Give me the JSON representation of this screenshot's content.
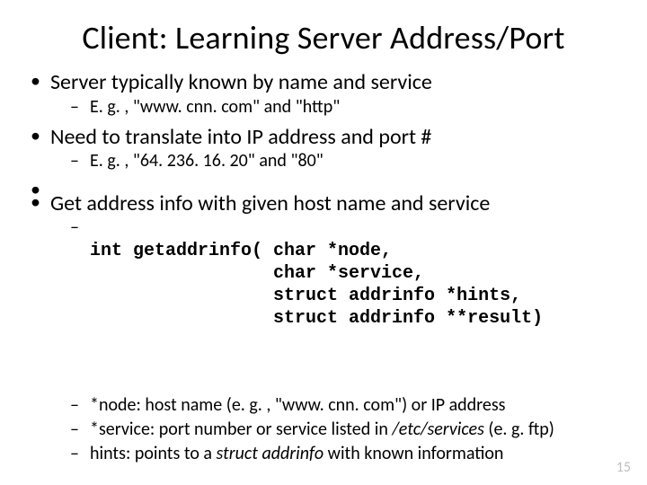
{
  "title": "Client: Learning Server Address/Port",
  "b1": {
    "text": "Server typically known by name and service",
    "sub1": "E. g. , \"www. cnn. com\" and \"http\""
  },
  "b2": {
    "text": "Need to translate into IP address and port #",
    "sub1": "E. g. , \"64. 236. 16. 20\" and \"80\""
  },
  "b3": {
    "text": "Get address info with given host name and service",
    "code": {
      "l1": "int getaddrinfo( char *node,",
      "l2": "                 char *service,",
      "l3": "                 struct addrinfo *hints,",
      "l4": "                 struct addrinfo **result)"
    },
    "p1_a": "*node: host name (e. g. , \"www. cnn. com\") or IP address",
    "p2_a": "*service: port number or service listed in ",
    "p2_b": "/etc/services",
    "p2_c": " (e. g. ftp)",
    "p3_a": "hints: points to a  ",
    "p3_b": "struct addrinfo",
    "p3_c": " with known information"
  },
  "page_number": "15"
}
